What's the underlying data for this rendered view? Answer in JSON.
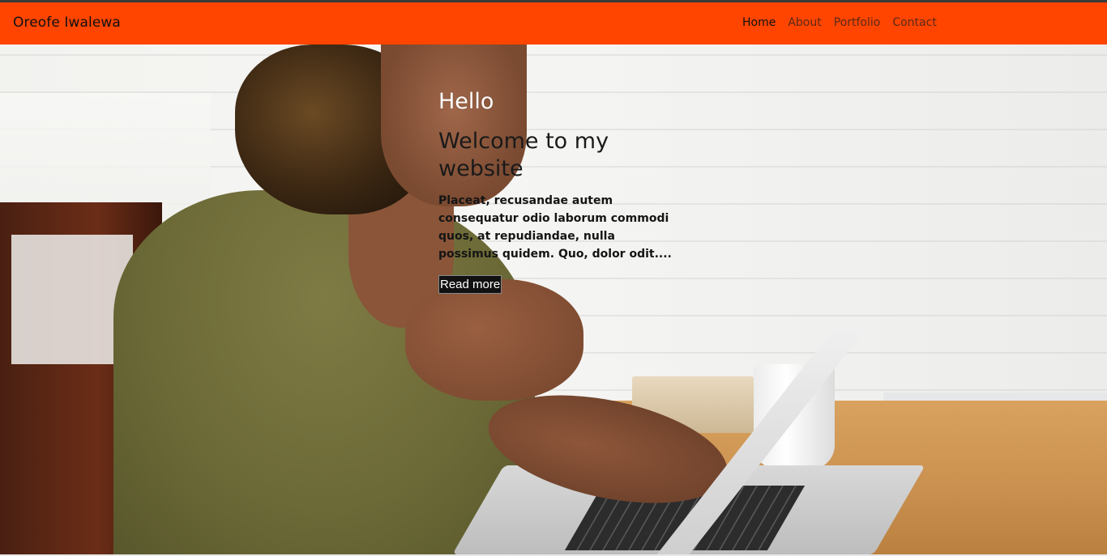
{
  "navbar": {
    "brand": "Oreofe Iwalewa",
    "links": [
      {
        "label": "Home",
        "active": true
      },
      {
        "label": "About",
        "active": false
      },
      {
        "label": "Portfolio",
        "active": false
      },
      {
        "label": "Contact",
        "active": false
      }
    ],
    "background_color": "#ff4500"
  },
  "hero": {
    "greeting": "Hello",
    "title": "Welcome to my website",
    "text": "Placeat, recusandae autem consequatur odio laborum commodi quos, at repudiandae, nulla possimus quidem. Quo, dolor odit....",
    "button_label": "Read more"
  }
}
